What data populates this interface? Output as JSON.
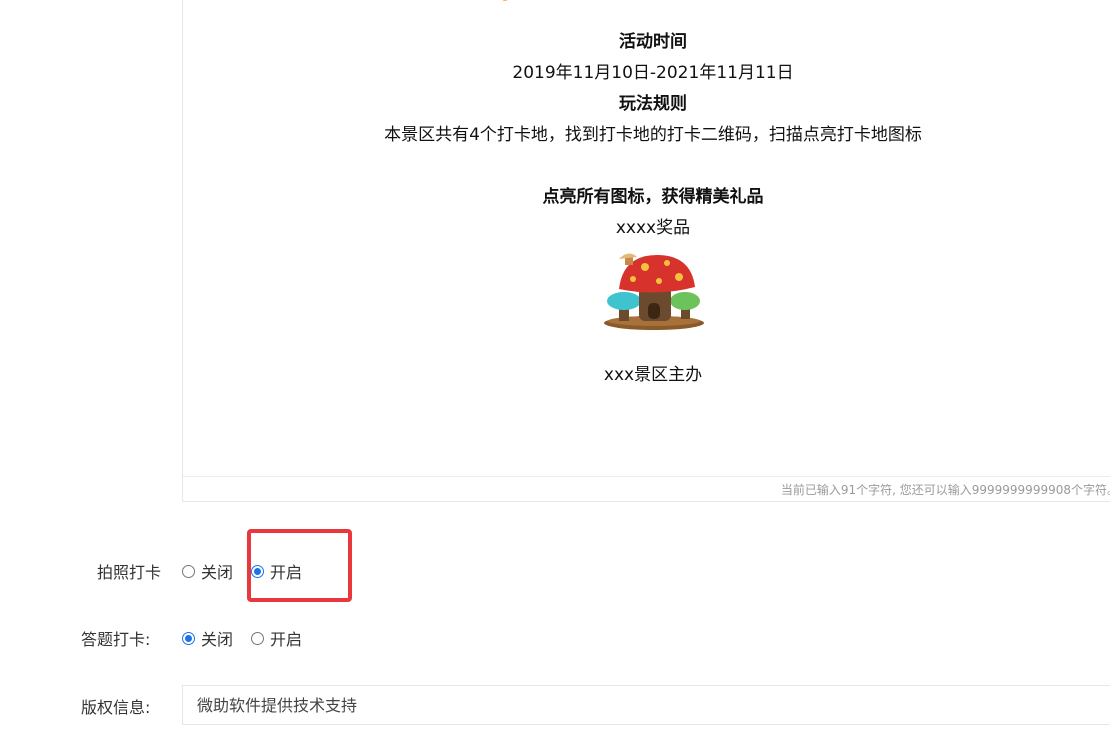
{
  "editor": {
    "title_activity_time": "活动时间",
    "activity_time": "2019年11月10日-2021年11月11日",
    "title_rules": "玩法规则",
    "rules": "本景区共有4个打卡地，找到打卡地的打卡二维码，扫描点亮打卡地图标",
    "title_prize": "点亮所有图标，获得精美礼品",
    "prize": "xxxx奖品",
    "image_icon": "mushroom-house-icon",
    "organizer": "xxx景区主办",
    "counter": "当前已输入91个字符, 您还可以输入9999999999908个字符。"
  },
  "photo_checkin": {
    "label": "拍照打卡",
    "option_off": "关闭",
    "option_on": "开启",
    "selected": "开启"
  },
  "quiz_checkin": {
    "label": "答题打卡:",
    "option_off": "关闭",
    "option_on": "开启",
    "selected": "关闭"
  },
  "copyright": {
    "label": "版权信息:",
    "value": "微助软件提供技术支持"
  },
  "colors": {
    "accent": "#1a73e8",
    "highlight": "#e8373d"
  }
}
